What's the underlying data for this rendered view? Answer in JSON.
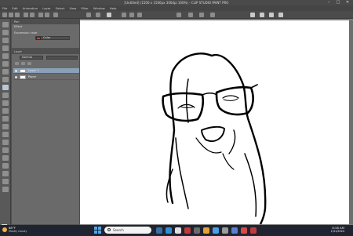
{
  "window": {
    "title": "[Untitled] (1500 x 1500px 300dpi 100%) - CLIP STUDIO PAINT PRO",
    "minimize": "–",
    "maximize": "□",
    "close": "✕"
  },
  "menu": [
    "File",
    "Edit",
    "Animation",
    "Layer",
    "Select",
    "View",
    "Filter",
    "Window",
    "Help"
  ],
  "panels": {
    "sub_tool_title": "Pen",
    "tool_property_title": "Effect",
    "expression_color_label": "Expression color",
    "expression_color_value": "Color",
    "layer_panel_title": "Layer",
    "blend_mode": "Normal",
    "layers": [
      "Layer 1",
      "Paper"
    ]
  },
  "taskbar": {
    "weather_temp": "68°F",
    "weather_desc": "Mostly cloudy",
    "search_placeholder": "Search",
    "time": "8:58 AM",
    "date": "1/31/2024"
  },
  "colors": {
    "accent": "#8aa0b8",
    "main_color": "#111111",
    "sub_color": "#ffffff",
    "taskbar": "#1f2430"
  }
}
